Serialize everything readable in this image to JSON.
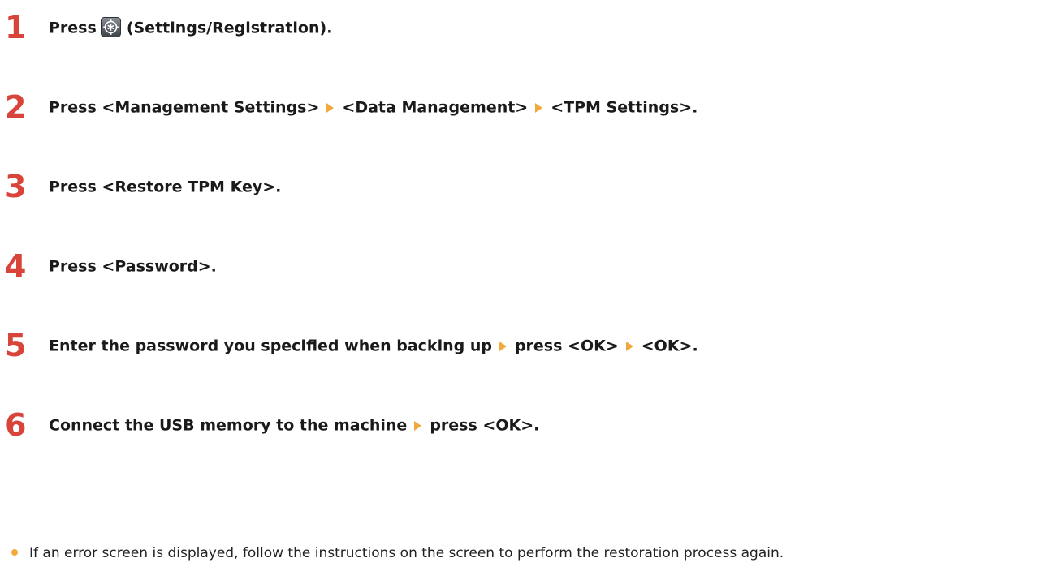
{
  "steps": [
    {
      "number": "1",
      "parts": [
        "Press",
        "(Settings/Registration)."
      ],
      "icon": "settings-registration-icon"
    },
    {
      "number": "2",
      "parts": [
        "Press <Management Settings>",
        "<Data Management>",
        "<TPM Settings>."
      ]
    },
    {
      "number": "3",
      "parts": [
        "Press <Restore TPM Key>."
      ]
    },
    {
      "number": "4",
      "parts": [
        "Press <Password>."
      ]
    },
    {
      "number": "5",
      "parts": [
        "Enter the password you specified when backing up",
        "press <OK>",
        "<OK>."
      ]
    },
    {
      "number": "6",
      "parts": [
        "Connect the USB memory to the machine",
        "press <OK>."
      ]
    }
  ],
  "note": "If an error screen is displayed, follow the instructions on the screen to perform the restoration process again.",
  "colors": {
    "step_number": "#d8443a",
    "arrow": "#f2a93b",
    "bullet": "#f2a93b",
    "text": "#1a1a1a"
  },
  "icons": {
    "separator": "triangle-right-icon",
    "bullet": "bullet-dot-icon"
  }
}
